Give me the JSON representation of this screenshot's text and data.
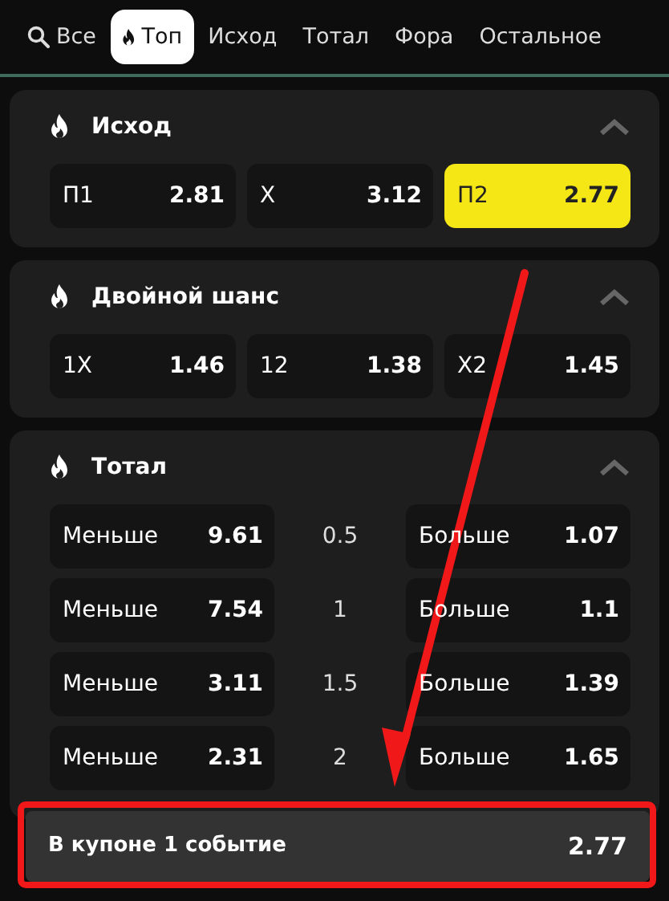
{
  "tabs": [
    {
      "label": "Все",
      "selected": false
    },
    {
      "label": "Топ",
      "selected": true
    },
    {
      "label": "Исход",
      "selected": false
    },
    {
      "label": "Тотал",
      "selected": false
    },
    {
      "label": "Фора",
      "selected": false
    },
    {
      "label": "Остальное",
      "selected": false
    }
  ],
  "sections": [
    {
      "title": "Исход",
      "kind": "outcomes",
      "expanded": true,
      "outcomes": [
        {
          "label": "П1",
          "odds": "2.81",
          "selected": false
        },
        {
          "label": "X",
          "odds": "3.12",
          "selected": false
        },
        {
          "label": "П2",
          "odds": "2.77",
          "selected": true
        }
      ]
    },
    {
      "title": "Двойной шанс",
      "kind": "outcomes",
      "expanded": true,
      "outcomes": [
        {
          "label": "1X",
          "odds": "1.46",
          "selected": false
        },
        {
          "label": "12",
          "odds": "1.38",
          "selected": false
        },
        {
          "label": "X2",
          "odds": "1.45",
          "selected": false
        }
      ]
    },
    {
      "title": "Тотал",
      "kind": "totals",
      "expanded": true,
      "rows": [
        {
          "under_label": "Меньше",
          "under_odds": "9.61",
          "line": "0.5",
          "over_label": "Больше",
          "over_odds": "1.07"
        },
        {
          "under_label": "Меньше",
          "under_odds": "7.54",
          "line": "1",
          "over_label": "Больше",
          "over_odds": "1.1"
        },
        {
          "under_label": "Меньше",
          "under_odds": "3.11",
          "line": "1.5",
          "over_label": "Больше",
          "over_odds": "1.39"
        },
        {
          "under_label": "Меньше",
          "under_odds": "2.31",
          "line": "2",
          "over_label": "Больше",
          "over_odds": "1.65"
        }
      ]
    }
  ],
  "coupon": {
    "text": "В купоне 1 событие",
    "odds": "2.77"
  }
}
